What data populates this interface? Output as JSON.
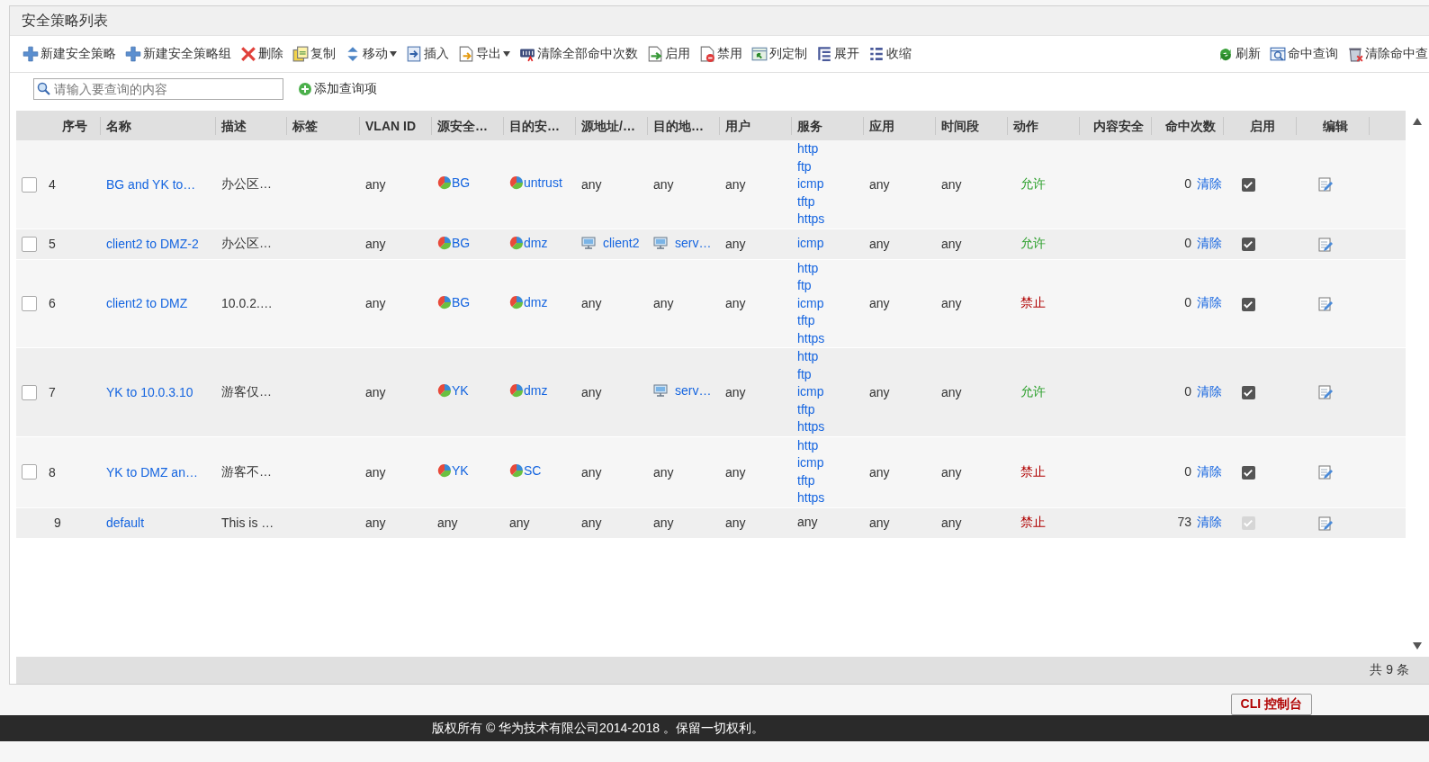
{
  "panel": {
    "title": "安全策略列表"
  },
  "toolbar": {
    "left": [
      {
        "kind": "plus",
        "label": "新建安全策略",
        "dropdown": false
      },
      {
        "kind": "plus",
        "label": "新建安全策略组",
        "dropdown": false
      },
      {
        "kind": "delete",
        "label": "删除",
        "dropdown": false
      },
      {
        "kind": "copy",
        "label": "复制",
        "dropdown": false
      },
      {
        "kind": "move",
        "label": "移动",
        "dropdown": true
      },
      {
        "kind": "insert",
        "label": "插入",
        "dropdown": false
      },
      {
        "kind": "export",
        "label": "导出",
        "dropdown": true
      },
      {
        "kind": "counter",
        "label": "清除全部命中次数",
        "dropdown": false
      },
      {
        "kind": "enable",
        "label": "启用",
        "dropdown": false
      },
      {
        "kind": "disable",
        "label": "禁用",
        "dropdown": false
      },
      {
        "kind": "columns",
        "label": "列定制",
        "dropdown": false
      },
      {
        "kind": "expand",
        "label": "展开",
        "dropdown": false
      },
      {
        "kind": "collapse",
        "label": "收缩",
        "dropdown": false
      }
    ],
    "right": [
      {
        "kind": "refresh",
        "label": "刷新",
        "dropdown": false
      },
      {
        "kind": "query",
        "label": "命中查询",
        "dropdown": false
      },
      {
        "kind": "trash",
        "label": "清除命中查",
        "dropdown": false
      }
    ]
  },
  "search": {
    "placeholder": "请输入要查询的内容",
    "add_button": "添加查询项"
  },
  "table": {
    "columns": [
      "序号",
      "名称",
      "描述",
      "标签",
      "VLAN ID",
      "源安全…",
      "目的安…",
      "源地址/…",
      "目的地…",
      "用户",
      "服务",
      "应用",
      "时间段",
      "动作",
      "内容安全",
      "命中次数",
      "启用",
      "编辑"
    ],
    "rows": [
      {
        "kind": "policy",
        "selected": false,
        "seq": "4",
        "name": "BG and YK to…",
        "desc": "办公区…",
        "vlan": "any",
        "src_zone": {
          "kind": "zone",
          "text": "BG"
        },
        "dst_zone": {
          "kind": "zone",
          "text": "untrust"
        },
        "src_addr": {
          "kind": "any",
          "text": "any"
        },
        "dst_addr": {
          "kind": "any",
          "text": "any"
        },
        "user": "any",
        "services": {
          "kind": "link",
          "items": [
            "http",
            "ftp",
            "icmp",
            "tftp",
            "https"
          ]
        },
        "app": "any",
        "time": "any",
        "action": {
          "kind": "permit",
          "text": "允许"
        },
        "hits": "0",
        "clear": "清除",
        "enabled": {
          "checked": true,
          "disabled": false
        }
      },
      {
        "kind": "policy",
        "selected": false,
        "seq": "5",
        "name": "client2 to DMZ-2",
        "desc": "办公区…",
        "vlan": "any",
        "src_zone": {
          "kind": "zone",
          "text": "BG"
        },
        "dst_zone": {
          "kind": "zone",
          "text": "dmz"
        },
        "src_addr": {
          "kind": "host",
          "text": "client2"
        },
        "dst_addr": {
          "kind": "host",
          "text": "serv…"
        },
        "user": "any",
        "services": {
          "kind": "link",
          "items": [
            "icmp"
          ]
        },
        "app": "any",
        "time": "any",
        "action": {
          "kind": "permit",
          "text": "允许"
        },
        "hits": "0",
        "clear": "清除",
        "enabled": {
          "checked": true,
          "disabled": false
        }
      },
      {
        "kind": "policy",
        "selected": false,
        "seq": "6",
        "name": "client2 to DMZ",
        "desc": "10.0.2.…",
        "vlan": "any",
        "src_zone": {
          "kind": "zone",
          "text": "BG"
        },
        "dst_zone": {
          "kind": "zone",
          "text": "dmz"
        },
        "src_addr": {
          "kind": "any",
          "text": "any"
        },
        "dst_addr": {
          "kind": "any",
          "text": "any"
        },
        "user": "any",
        "services": {
          "kind": "link",
          "items": [
            "http",
            "ftp",
            "icmp",
            "tftp",
            "https"
          ]
        },
        "app": "any",
        "time": "any",
        "action": {
          "kind": "deny",
          "text": "禁止"
        },
        "hits": "0",
        "clear": "清除",
        "enabled": {
          "checked": true,
          "disabled": false
        }
      },
      {
        "kind": "policy",
        "selected": false,
        "seq": "7",
        "name": "YK to 10.0.3.10",
        "desc": "游客仅…",
        "vlan": "any",
        "src_zone": {
          "kind": "zone",
          "text": "YK"
        },
        "dst_zone": {
          "kind": "zone",
          "text": "dmz"
        },
        "src_addr": {
          "kind": "any",
          "text": "any"
        },
        "dst_addr": {
          "kind": "host",
          "text": "serv…"
        },
        "user": "any",
        "services": {
          "kind": "link",
          "items": [
            "http",
            "ftp",
            "icmp",
            "tftp",
            "https"
          ]
        },
        "app": "any",
        "time": "any",
        "action": {
          "kind": "permit",
          "text": "允许"
        },
        "hits": "0",
        "clear": "清除",
        "enabled": {
          "checked": true,
          "disabled": false
        }
      },
      {
        "kind": "policy",
        "selected": false,
        "seq": "8",
        "name": "YK to DMZ an…",
        "desc": "游客不…",
        "vlan": "any",
        "src_zone": {
          "kind": "zone",
          "text": "YK"
        },
        "dst_zone": {
          "kind": "zone",
          "text": "SC"
        },
        "src_addr": {
          "kind": "any",
          "text": "any"
        },
        "dst_addr": {
          "kind": "any",
          "text": "any"
        },
        "user": "any",
        "services": {
          "kind": "link",
          "items": [
            "http",
            "icmp",
            "tftp",
            "https"
          ]
        },
        "app": "any",
        "time": "any",
        "action": {
          "kind": "deny",
          "text": "禁止"
        },
        "hits": "0",
        "clear": "清除",
        "enabled": {
          "checked": true,
          "disabled": false
        }
      },
      {
        "kind": "default",
        "seq": "9",
        "name": "default",
        "desc": "This is …",
        "vlan": "any",
        "src_zone": {
          "kind": "any",
          "text": "any"
        },
        "dst_zone": {
          "kind": "any",
          "text": "any"
        },
        "src_addr": {
          "kind": "any",
          "text": "any"
        },
        "dst_addr": {
          "kind": "any",
          "text": "any"
        },
        "user": "any",
        "services": {
          "kind": "plain",
          "items": [
            "any"
          ]
        },
        "app": "any",
        "time": "any",
        "action": {
          "kind": "deny",
          "text": "禁止"
        },
        "hits": "73",
        "clear": "清除",
        "enabled": {
          "checked": true,
          "disabled": true
        }
      }
    ],
    "total": "共 9 条"
  },
  "cli_button": "CLI 控制台",
  "footer": {
    "copyright": "版权所有 © 华为技术有限公司2014-2018 。保留一切权利。"
  }
}
